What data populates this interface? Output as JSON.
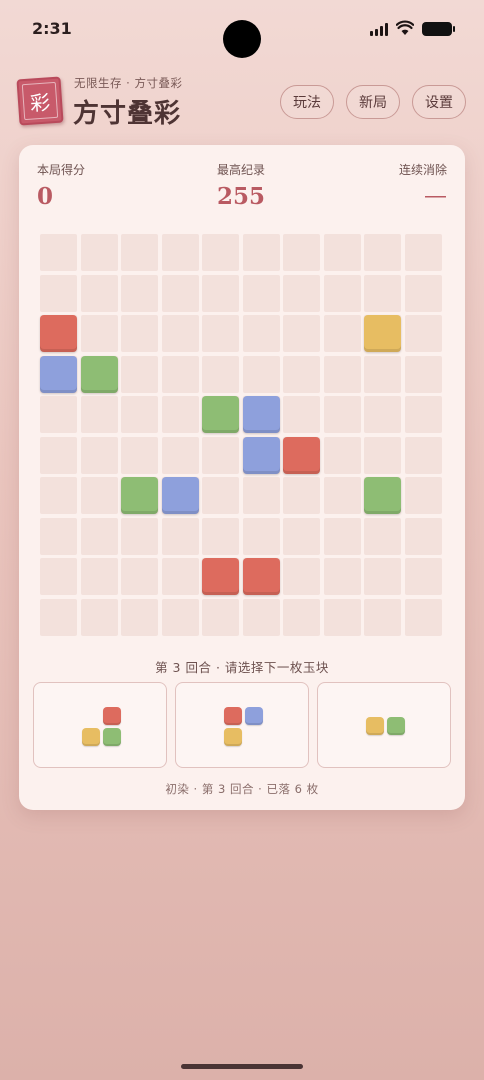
{
  "status": {
    "time": "2:31"
  },
  "header": {
    "logo_char": "彩",
    "subtitle": "无限生存 · 方寸叠彩",
    "title": "方寸叠彩",
    "buttons": {
      "rules": "玩法",
      "new_game": "新局",
      "settings": "设置"
    }
  },
  "stats": {
    "score_label": "本局得分",
    "score_value": "0",
    "best_label": "最高纪录",
    "best_value": "255",
    "combo_label": "连续消除",
    "combo_value": "—"
  },
  "colors": {
    "red": "#dd6b5e",
    "blue": "#8ea0dc",
    "green": "#8ebd74",
    "yellow": "#e7bd62"
  },
  "board": {
    "rows": 10,
    "cols": 10,
    "tiles": [
      {
        "row": 2,
        "col": 0,
        "color": "red"
      },
      {
        "row": 2,
        "col": 8,
        "color": "yellow"
      },
      {
        "row": 3,
        "col": 0,
        "color": "blue"
      },
      {
        "row": 3,
        "col": 1,
        "color": "green"
      },
      {
        "row": 4,
        "col": 4,
        "color": "green"
      },
      {
        "row": 4,
        "col": 5,
        "color": "blue"
      },
      {
        "row": 5,
        "col": 5,
        "color": "blue"
      },
      {
        "row": 5,
        "col": 6,
        "color": "red"
      },
      {
        "row": 6,
        "col": 2,
        "color": "green"
      },
      {
        "row": 6,
        "col": 3,
        "color": "blue"
      },
      {
        "row": 6,
        "col": 8,
        "color": "green"
      },
      {
        "row": 8,
        "col": 4,
        "color": "red"
      },
      {
        "row": 8,
        "col": 5,
        "color": "red"
      }
    ]
  },
  "round_prompt": "第 3 回合 · 请选择下一枚玉块",
  "pieces": [
    {
      "cells": [
        {
          "row": 0,
          "col": 1,
          "color": "red"
        },
        {
          "row": 1,
          "col": 0,
          "color": "yellow"
        },
        {
          "row": 1,
          "col": 1,
          "color": "green"
        }
      ]
    },
    {
      "cells": [
        {
          "row": 0,
          "col": 0,
          "color": "red"
        },
        {
          "row": 0,
          "col": 1,
          "color": "blue"
        },
        {
          "row": 1,
          "col": 0,
          "color": "yellow"
        }
      ]
    },
    {
      "cells": [
        {
          "row": 0,
          "col": 0,
          "color": "yellow"
        },
        {
          "row": 0,
          "col": 1,
          "color": "green"
        }
      ]
    }
  ],
  "footer_status": "初染 · 第 3 回合 · 已落 6 枚"
}
